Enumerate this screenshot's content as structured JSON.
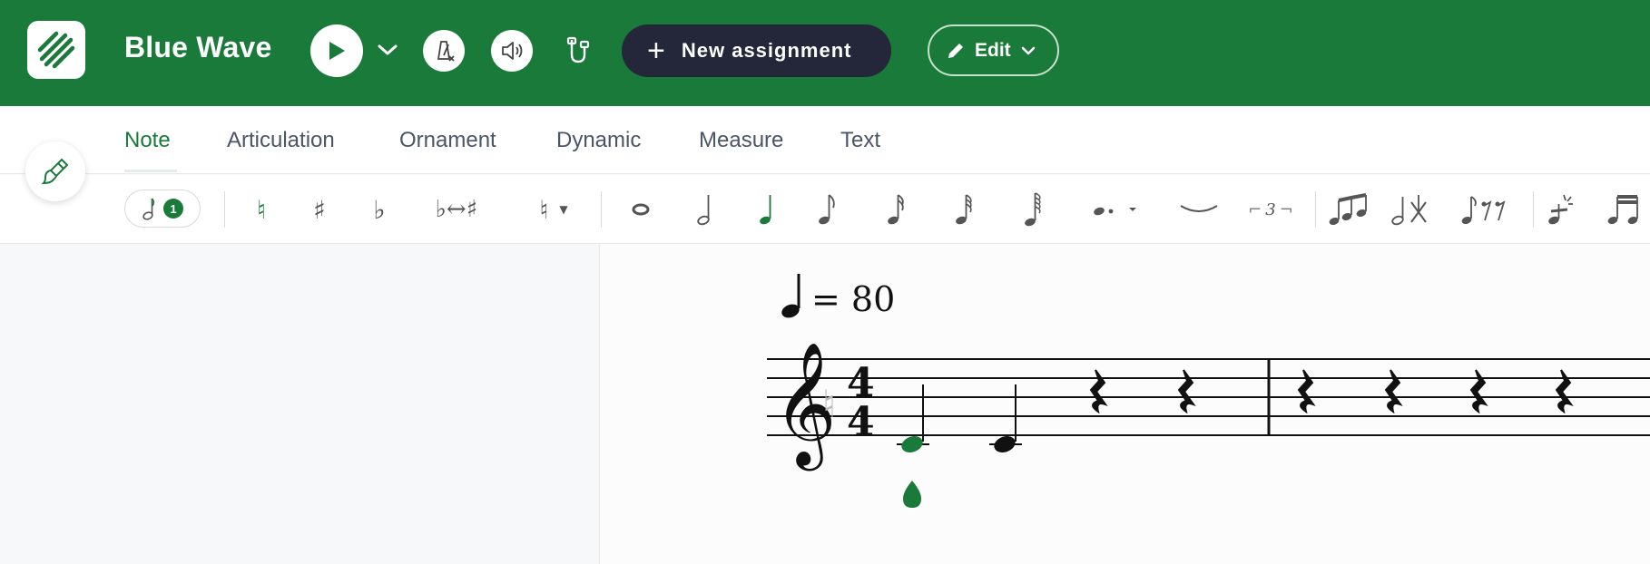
{
  "header": {
    "title": "Blue Wave",
    "new_assignment_label": "New assignment",
    "edit_label": "Edit",
    "colors": {
      "bar": "#1a7a3a",
      "assign_bg": "#24263a"
    }
  },
  "tabs": [
    {
      "label": "Note",
      "active": true
    },
    {
      "label": "Articulation"
    },
    {
      "label": "Ornament"
    },
    {
      "label": "Dynamic"
    },
    {
      "label": "Measure"
    },
    {
      "label": "Text"
    }
  ],
  "toolbar": {
    "selected_count": "1",
    "tools": [
      "natural-icon",
      "sharp-icon",
      "flat-icon",
      "enharmonic-icon",
      "accidental-menu-icon",
      "whole-note-icon",
      "half-note-icon",
      "quarter-note-icon",
      "eighth-note-icon",
      "sixteenth-note-icon",
      "thirty-second-note-icon",
      "sixty-fourth-note-icon",
      "dot-icon",
      "tie-icon",
      "triplet-icon",
      "beam-icon",
      "cross-notehead-icon",
      "rests-icon",
      "grace-note-icon",
      "beam-group-icon"
    ],
    "enharmonic_label": "♭↔♯",
    "triplet_label": "3"
  },
  "score": {
    "tempo_value": "= 80",
    "time_signature": [
      "4",
      "4"
    ],
    "measures": [
      [
        "C4 quarter (selected)",
        "C4 quarter",
        "quarter rest",
        "quarter rest"
      ],
      [
        "quarter rest",
        "quarter rest",
        "quarter rest",
        "quarter rest"
      ]
    ],
    "accent_color": "#1a7a3a"
  }
}
